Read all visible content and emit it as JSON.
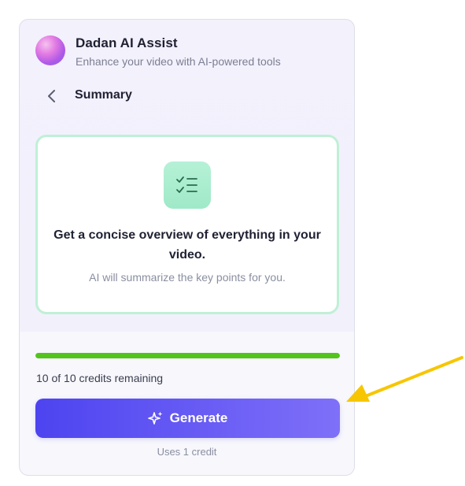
{
  "app": {
    "title": "Dadan AI Assist",
    "subtitle": "Enhance your video with AI-powered tools"
  },
  "nav": {
    "back_icon": "chevron-left-icon",
    "title": "Summary"
  },
  "feature": {
    "icon": "checklist-icon",
    "heading": "Get a concise overview of everything in your video.",
    "description": "AI will summarize the key points for you."
  },
  "credits": {
    "remaining": 10,
    "total": 10,
    "text": "10 of 10 credits remaining",
    "progress_fraction": 1.0
  },
  "generate": {
    "icon": "sparkle-icon",
    "label": "Generate",
    "note": "Uses 1 credit"
  },
  "annotation": {
    "icon": "pointer-arrow-icon",
    "color": "#f7c600"
  },
  "colors": {
    "accent": "#5a4ff2",
    "progress": "#53c41b",
    "card_border": "#bff0d6"
  }
}
